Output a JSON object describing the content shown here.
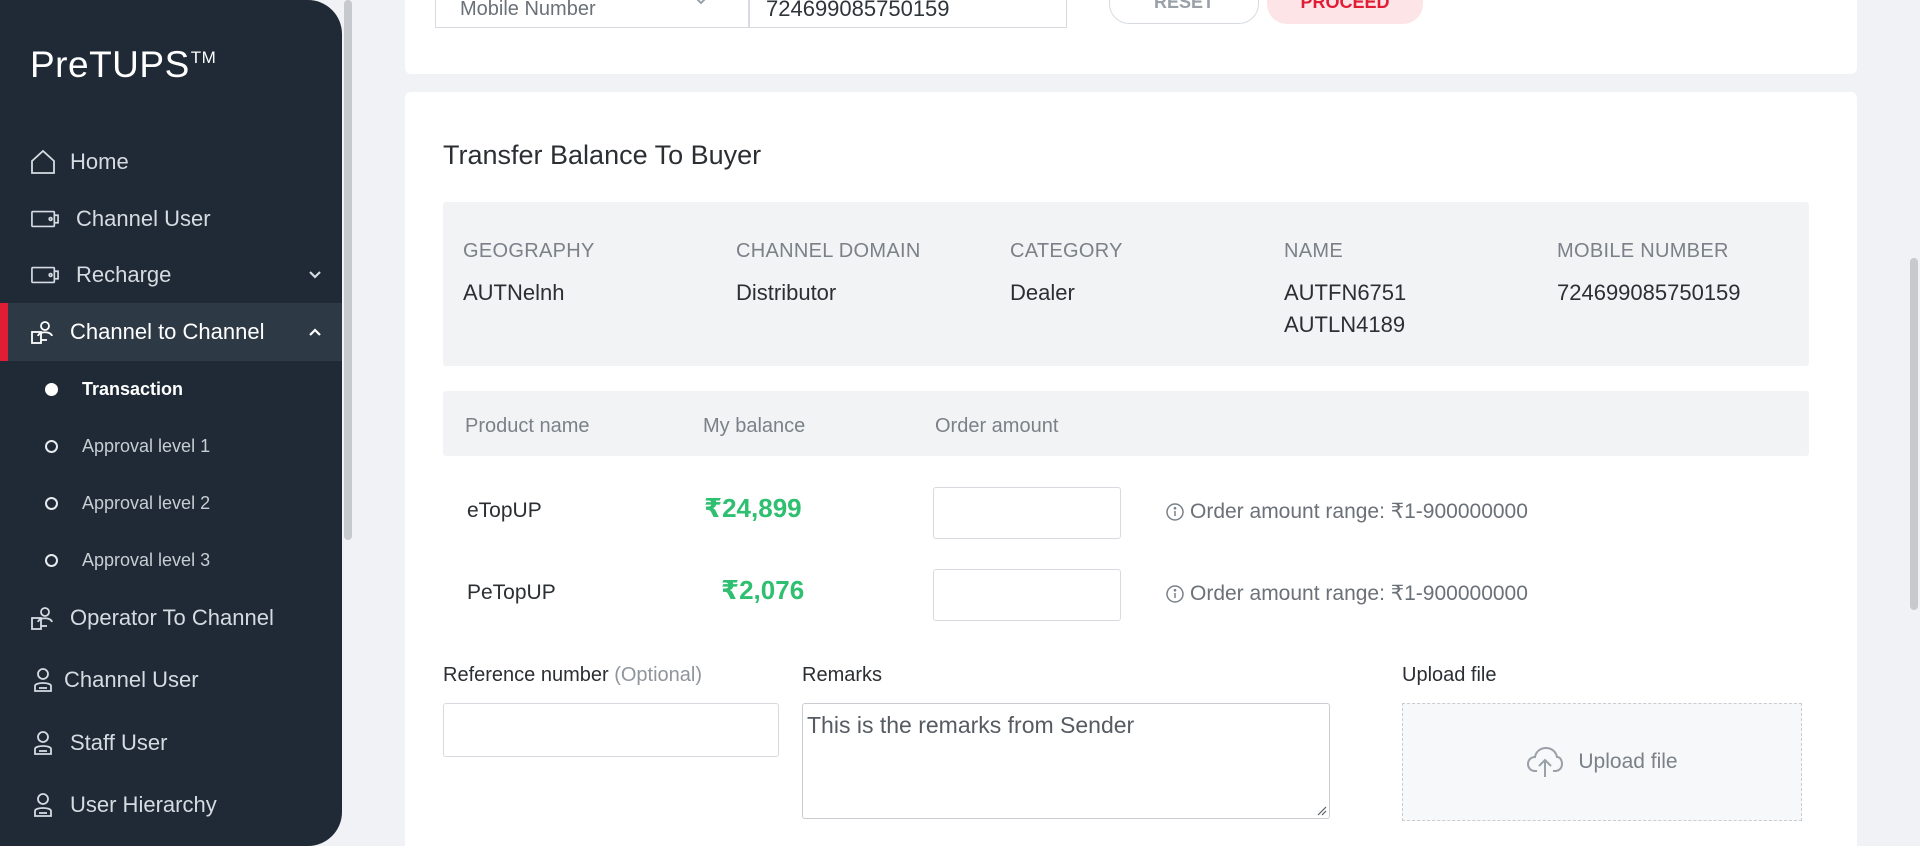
{
  "brand": {
    "name": "PreTUPS",
    "tm": "TM"
  },
  "sidebar": {
    "items": [
      {
        "label": "Home",
        "icon": "home-icon"
      },
      {
        "label": "Channel User",
        "icon": "card-icon"
      },
      {
        "label": "Recharge",
        "icon": "card-icon",
        "expandable": true
      },
      {
        "label": "Channel to Channel",
        "icon": "transfer-users-icon",
        "active": true,
        "expanded": true
      },
      {
        "label": "Operator To Channel",
        "icon": "transfer-users-icon"
      },
      {
        "label": "Channel User",
        "icon": "user-icon"
      },
      {
        "label": "Staff User",
        "icon": "user-icon"
      },
      {
        "label": "User Hierarchy",
        "icon": "user-icon"
      }
    ],
    "subitems": [
      {
        "label": "Transaction",
        "active": true
      },
      {
        "label": "Approval level 1"
      },
      {
        "label": "Approval level 2"
      },
      {
        "label": "Approval level 3"
      }
    ]
  },
  "search": {
    "select_value": "Mobile Number",
    "number_value": "724699085750159",
    "reset_label": "RESET",
    "proceed_label": "PROCEED"
  },
  "transfer": {
    "title": "Transfer Balance To Buyer",
    "info": {
      "geography_label": "GEOGRAPHY",
      "geography_value": "AUTNelnh",
      "domain_label": "CHANNEL DOMAIN",
      "domain_value": "Distributor",
      "category_label": "CATEGORY",
      "category_value": "Dealer",
      "name_label": "NAME",
      "name_line1": "AUTFN6751",
      "name_line2": "AUTLN4189",
      "mobile_label": "MOBILE NUMBER",
      "mobile_value": "724699085750159"
    },
    "table": {
      "headers": {
        "product": "Product name",
        "balance": "My balance",
        "order": "Order amount"
      },
      "rows": [
        {
          "product": "eTopUP",
          "balance": "₹24,899",
          "order": "",
          "range": "Order amount range: ₹1-900000000"
        },
        {
          "product": "PeTopUP",
          "balance": "₹2,076",
          "order": "",
          "range": "Order amount range: ₹1-900000000"
        }
      ]
    },
    "form": {
      "reference_label": "Reference number",
      "reference_optional": "(Optional)",
      "reference_value": "",
      "remarks_label": "Remarks",
      "remarks_value": "This is the remarks from Sender",
      "upload_label": "Upload file",
      "upload_button": "Upload file"
    }
  },
  "colors": {
    "accent": "#e11d36",
    "sidebar": "#1f2a36",
    "balance": "#2fbf71"
  }
}
